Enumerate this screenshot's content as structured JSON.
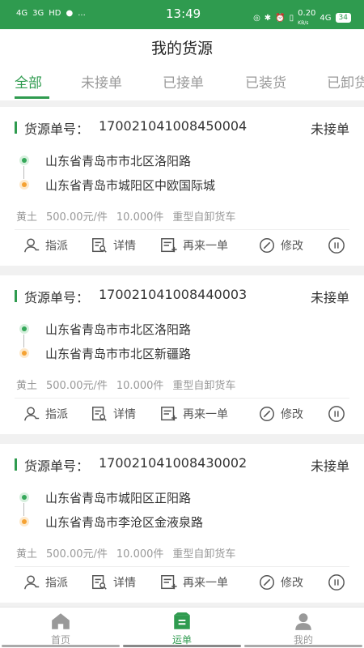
{
  "status_bar": {
    "left_icons": [
      "4G",
      "3G",
      "HD",
      "wechat-icon",
      "..."
    ],
    "time": "13:49",
    "net_speed": "0.20",
    "net_unit": "KB/s",
    "network": "4G",
    "battery": "34"
  },
  "header": {
    "title": "我的货源"
  },
  "tabs": [
    {
      "label": "全部",
      "active": true
    },
    {
      "label": "未接单",
      "active": false
    },
    {
      "label": "已接单",
      "active": false
    },
    {
      "label": "已装货",
      "active": false
    },
    {
      "label": "已卸货",
      "active": false
    }
  ],
  "cards": [
    {
      "label": "货源单号：",
      "number": "17002104100845000 4",
      "number_display": "170021041008450004",
      "status": "未接单",
      "from": "山东省青岛市市北区洛阳路",
      "to": "山东省青岛市城阳区中欧国际城",
      "goods": "黄土",
      "price": "500.00元/件",
      "quantity": "10.000件",
      "truck": "重型自卸货车"
    },
    {
      "label": "货源单号：",
      "number_display": "170021041008440003",
      "status": "未接单",
      "from": "山东省青岛市市北区洛阳路",
      "to": "山东省青岛市市北区新疆路",
      "goods": "黄土",
      "price": "500.00元/件",
      "quantity": "10.000件",
      "truck": "重型自卸货车"
    },
    {
      "label": "货源单号：",
      "number_display": "170021041008430002",
      "status": "未接单",
      "from": "山东省青岛市城阳区正阳路",
      "to": "山东省青岛市李沧区金液泉路",
      "goods": "黄土",
      "price": "500.00元/件",
      "quantity": "10.000件",
      "truck": "重型自卸货车"
    }
  ],
  "actions": {
    "assign": "指派",
    "detail": "详情",
    "repeat": "再来一单",
    "edit": "修改"
  },
  "bottom_nav": [
    {
      "label": "首页",
      "icon": "home-icon"
    },
    {
      "label": "运单",
      "icon": "waybill-icon",
      "active": true
    },
    {
      "label": "我的",
      "icon": "user-icon"
    }
  ],
  "colors": {
    "accent": "#2f9b4f",
    "origin": "#35a85a",
    "destination": "#f5a233"
  }
}
